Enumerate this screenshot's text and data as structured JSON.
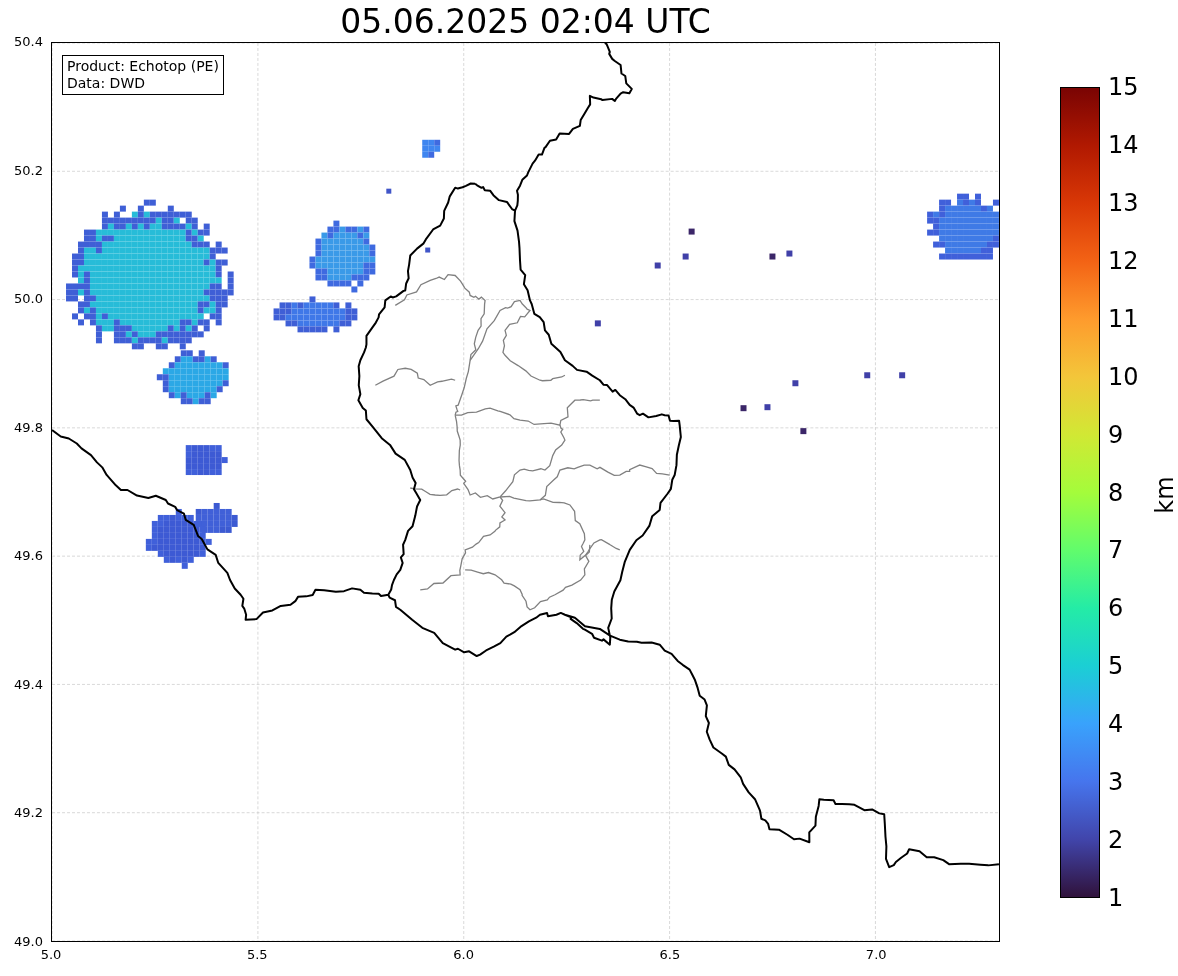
{
  "title": "05.06.2025 02:04 UTC",
  "legend": {
    "lines": [
      "Product: Echotop (PE)",
      "Data: DWD"
    ]
  },
  "x_ticks": [
    "5.0",
    "5.5",
    "6.0",
    "6.5",
    "7.0"
  ],
  "y_ticks": [
    "50.4",
    "50.2",
    "50.0",
    "49.8",
    "49.6",
    "49.4",
    "49.2",
    "49.0"
  ],
  "colorbar": {
    "label": "km",
    "ticks": [
      "15",
      "14",
      "13",
      "12",
      "11",
      "10",
      "9",
      "8",
      "7",
      "6",
      "5",
      "4",
      "3",
      "2",
      "1"
    ]
  }
}
